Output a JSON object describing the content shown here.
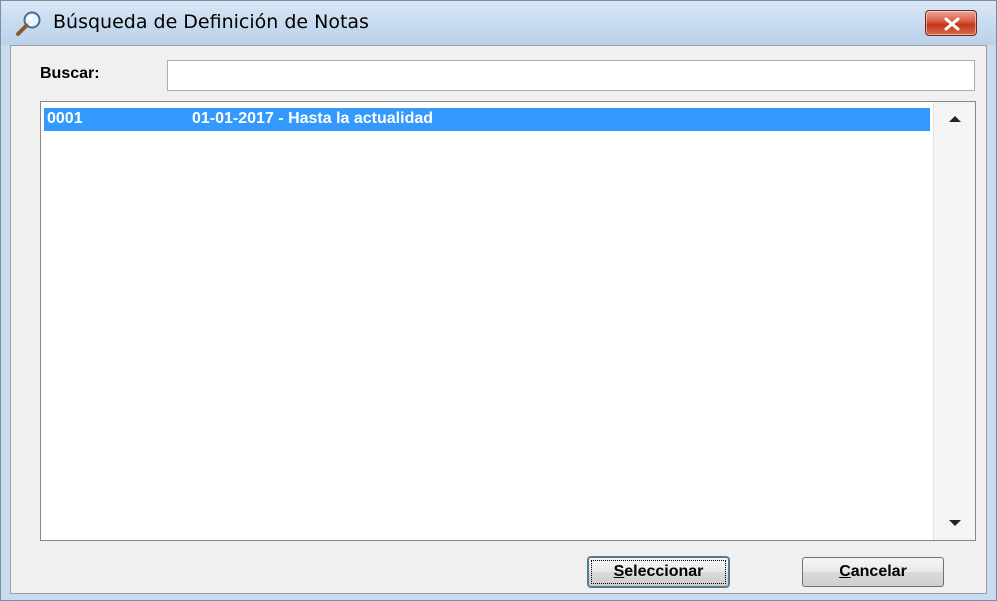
{
  "window": {
    "title": "Búsqueda de Definición de Notas",
    "title_icon": "magnifier-icon",
    "close_icon": "close-icon"
  },
  "search": {
    "label": "Buscar:",
    "value": "",
    "placeholder": ""
  },
  "list": {
    "rows": [
      {
        "code": "0001",
        "description": "01-01-2017 - Hasta la actualidad",
        "selected": true
      }
    ],
    "selection_color": "#3399ff"
  },
  "buttons": {
    "select_accel": "S",
    "select_rest": "eleccionar",
    "cancel_accel": "C",
    "cancel_rest": "ancelar"
  },
  "colors": {
    "title_bar": "#c8dbef",
    "close_button": "#d9583e",
    "dialog_bg": "#f0f0f0"
  }
}
